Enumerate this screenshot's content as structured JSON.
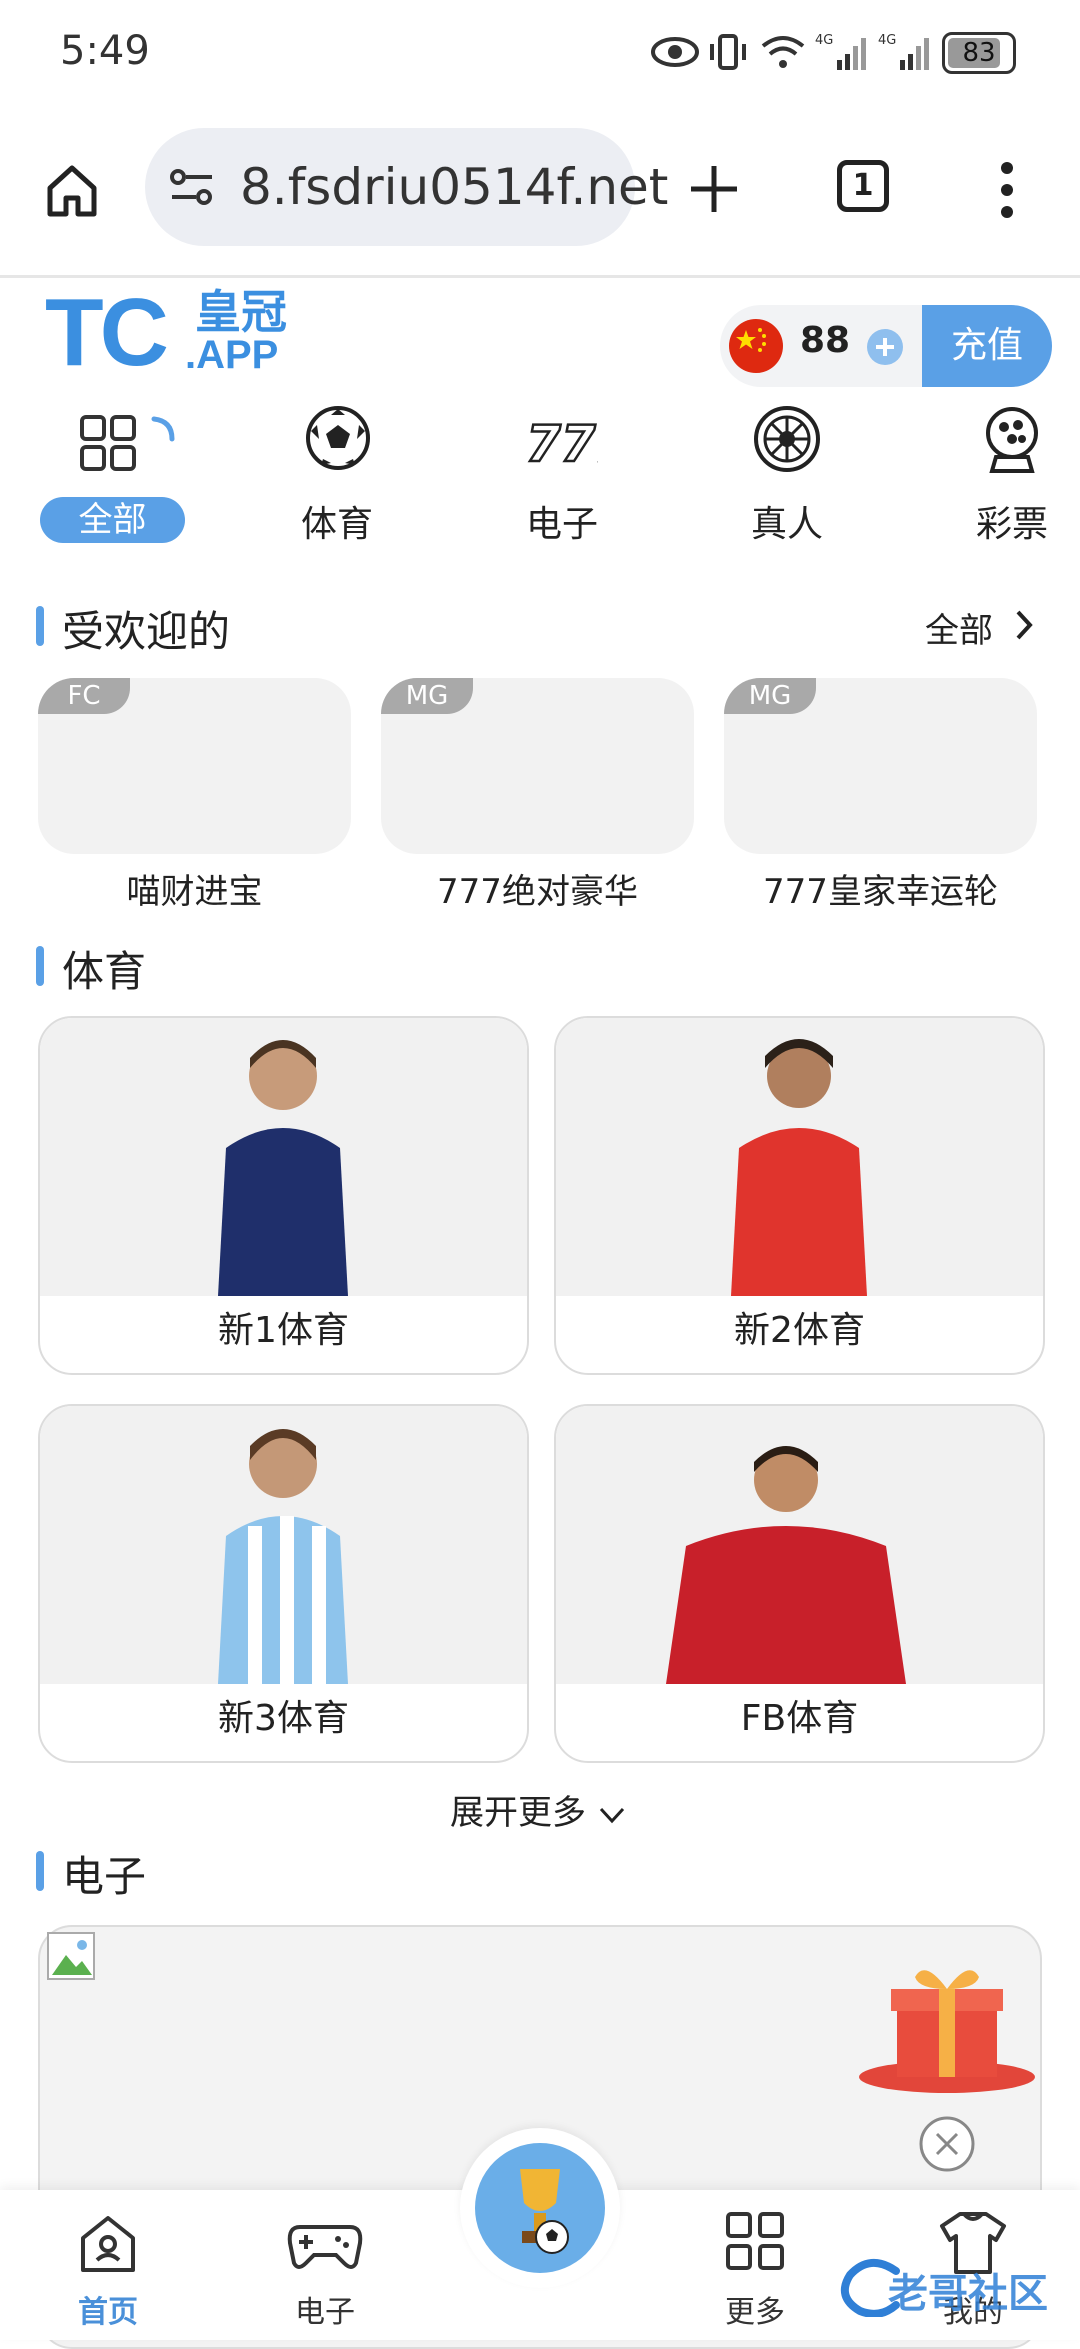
{
  "status_bar": {
    "time": "5:49",
    "battery": "83"
  },
  "browser": {
    "url": "8.fsdriu0514f.net",
    "tab_count": "1"
  },
  "header": {
    "logo_main": "TC",
    "logo_sub1": "皇冠",
    "logo_sub2": ".APP",
    "balance": "88",
    "recharge_label": "充值"
  },
  "categories": [
    {
      "label": "全部",
      "icon": "grid-icon",
      "active": true
    },
    {
      "label": "体育",
      "icon": "soccer-ball-icon"
    },
    {
      "label": "电子",
      "icon": "slot-777-icon"
    },
    {
      "label": "真人",
      "icon": "roulette-icon"
    },
    {
      "label": "彩票",
      "icon": "lottery-ball-icon"
    }
  ],
  "popular": {
    "title": "受欢迎的",
    "all_label": "全部",
    "items": [
      {
        "tag": "FC",
        "name": "喵财进宝"
      },
      {
        "tag": "MG",
        "name": "777绝对豪华"
      },
      {
        "tag": "MG",
        "name": "777皇家幸运轮"
      }
    ]
  },
  "sports": {
    "title": "体育",
    "items": [
      {
        "name": "新1体育",
        "shirt_color": "#1f2f6b"
      },
      {
        "name": "新2体育",
        "shirt_color": "#e0342d"
      },
      {
        "name": "新3体育",
        "shirt_color": "#8ec4ec"
      },
      {
        "name": "FB体育",
        "shirt_color": "#c8202a"
      }
    ],
    "expand_label": "展开更多"
  },
  "electronic": {
    "title": "电子"
  },
  "bottom_nav": [
    {
      "label": "首页",
      "icon": "home-icon",
      "active": true
    },
    {
      "label": "电子",
      "icon": "gamepad-icon"
    },
    {
      "label": "更多",
      "icon": "grid-icon"
    },
    {
      "label": "我的",
      "icon": "shirt-icon"
    }
  ],
  "watermark": "老哥社区",
  "colors": {
    "accent": "#5aa0e6",
    "card_bg": "#f2f2f2"
  }
}
